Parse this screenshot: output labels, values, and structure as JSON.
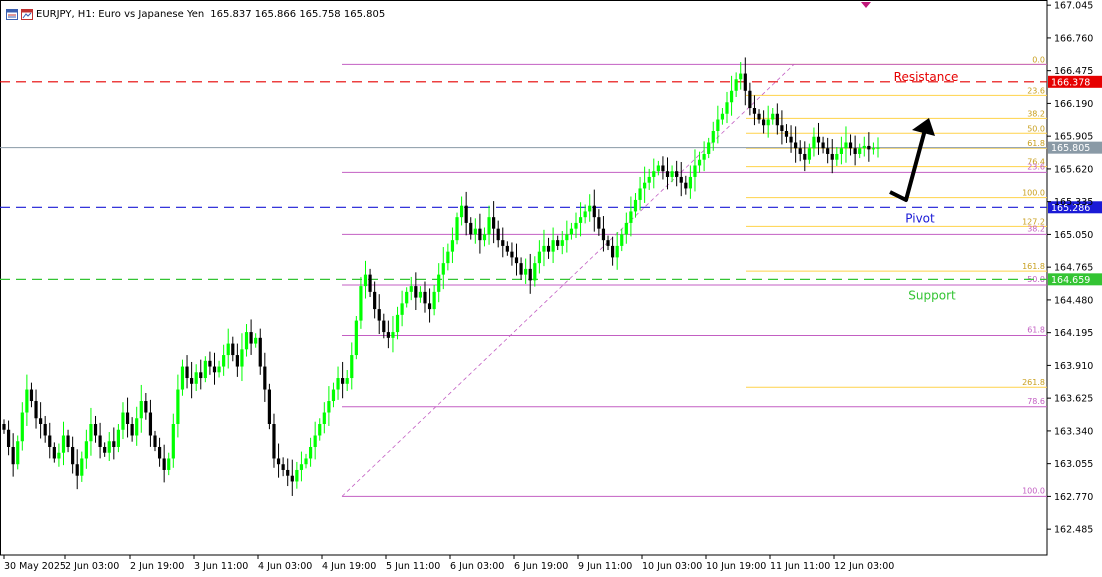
{
  "header": {
    "symbol_line": "EURJPY, H1: Euro vs Japanese Yen",
    "ohlc": "165.837 165.866 165.758 165.805",
    "icons": [
      "chart-window-icon",
      "chart-timeframe-icon"
    ]
  },
  "colors": {
    "bull": "#00ff00",
    "bear": "#000000",
    "fib_upper": "#ffd24a",
    "fib_lower": "#c35fc3",
    "resistance": "#e60000",
    "pivot": "#1a1ad6",
    "support": "#33c433",
    "price_line": "#8a9aa6",
    "axis_text": "#000000"
  },
  "chart_data": {
    "type": "candlestick",
    "symbol": "EURJPY",
    "timeframe": "H1",
    "y_ticks": [
      "167.045",
      "166.760",
      "166.475",
      "166.190",
      "165.905",
      "165.620",
      "165.335",
      "165.050",
      "164.765",
      "164.480",
      "164.195",
      "163.910",
      "163.625",
      "163.340",
      "163.055",
      "162.770",
      "162.485"
    ],
    "ylim": [
      162.26,
      167.09
    ],
    "x_ticks": [
      "30 May 2025",
      "2 Jun 03:00",
      "2 Jun 19:00",
      "3 Jun 11:00",
      "4 Jun 03:00",
      "4 Jun 19:00",
      "5 Jun 11:00",
      "6 Jun 03:00",
      "6 Jun 19:00",
      "9 Jun 11:00",
      "10 Jun 03:00",
      "10 Jun 19:00",
      "11 Jun 11:00",
      "12 Jun 03:00"
    ],
    "bar_count": 192,
    "closes": [
      163.35,
      163.2,
      163.05,
      163.25,
      163.5,
      163.7,
      163.6,
      163.45,
      163.4,
      163.3,
      163.2,
      163.1,
      163.15,
      163.3,
      163.2,
      163.05,
      162.95,
      163.1,
      163.25,
      163.4,
      163.3,
      163.2,
      163.15,
      163.25,
      163.2,
      163.35,
      163.5,
      163.4,
      163.3,
      163.45,
      163.6,
      163.5,
      163.3,
      163.2,
      163.1,
      163.0,
      163.1,
      163.4,
      163.7,
      163.9,
      163.8,
      163.75,
      163.85,
      163.8,
      163.95,
      163.9,
      163.85,
      163.9,
      164.0,
      164.1,
      164.0,
      163.9,
      164.05,
      164.2,
      164.1,
      164.15,
      163.9,
      163.7,
      163.4,
      163.1,
      163.05,
      163.0,
      162.95,
      162.9,
      163.0,
      163.05,
      163.1,
      163.2,
      163.3,
      163.4,
      163.5,
      163.6,
      163.7,
      163.8,
      163.75,
      163.8,
      164.0,
      164.3,
      164.6,
      164.7,
      164.55,
      164.4,
      164.3,
      164.2,
      164.15,
      164.2,
      164.35,
      164.45,
      164.55,
      164.6,
      164.5,
      164.55,
      164.45,
      164.4,
      164.55,
      164.7,
      164.8,
      164.9,
      165.0,
      165.2,
      165.3,
      165.15,
      165.05,
      165.1,
      165.0,
      165.05,
      165.2,
      165.1,
      165.0,
      164.95,
      164.9,
      164.85,
      164.8,
      164.7,
      164.75,
      164.65,
      164.8,
      164.9,
      164.95,
      164.9,
      165.0,
      164.95,
      165.0,
      165.05,
      165.1,
      165.15,
      165.2,
      165.25,
      165.3,
      165.2,
      165.1,
      165.0,
      164.95,
      164.85,
      164.95,
      165.05,
      165.15,
      165.25,
      165.35,
      165.45,
      165.5,
      165.55,
      165.6,
      165.65,
      165.6,
      165.55,
      165.6,
      165.55,
      165.5,
      165.45,
      165.55,
      165.65,
      165.7,
      165.75,
      165.85,
      165.95,
      166.05,
      166.1,
      166.2,
      166.3,
      166.4,
      166.45,
      166.3,
      166.15,
      166.1,
      166.05,
      166.0,
      166.05,
      166.1,
      166.0,
      165.95,
      165.9,
      165.85,
      165.8,
      165.75,
      165.7,
      165.8,
      165.9,
      165.85,
      165.8,
      165.75,
      165.7,
      165.75,
      165.8,
      165.85,
      165.8,
      165.75,
      165.8,
      165.82,
      165.79,
      165.8,
      165.805
    ],
    "fibonacci": {
      "upper_levels": [
        {
          "label": "0.0",
          "price": 166.53
        },
        {
          "label": "23.6",
          "price": 166.26
        },
        {
          "label": "38.2",
          "price": 166.06
        },
        {
          "label": "50.0",
          "price": 165.93
        },
        {
          "label": "61.8",
          "price": 165.8
        },
        {
          "label": "76.4",
          "price": 165.64
        },
        {
          "label": "100.0",
          "price": 165.37
        },
        {
          "label": "127.2",
          "price": 165.12
        },
        {
          "label": "161.8",
          "price": 164.73
        },
        {
          "label": "261.8",
          "price": 163.72
        }
      ],
      "lower_levels": [
        {
          "label": "0.0",
          "price": 166.53
        },
        {
          "label": "23.6",
          "price": 165.59
        },
        {
          "label": "38.2",
          "price": 165.05
        },
        {
          "label": "50.0",
          "price": 164.61
        },
        {
          "label": "61.8",
          "price": 164.17
        },
        {
          "label": "78.6",
          "price": 163.55
        },
        {
          "label": "100.0",
          "price": 162.77
        }
      ]
    },
    "levels": [
      {
        "name": "Resistance",
        "price": 166.378,
        "label": "166.378",
        "color_key": "resistance"
      },
      {
        "name": "Pivot",
        "price": 165.286,
        "label": "165.286",
        "color_key": "pivot"
      },
      {
        "name": "Support",
        "price": 164.659,
        "label": "164.659",
        "color_key": "support"
      }
    ],
    "current_price": {
      "price": 165.805,
      "label": "165.805"
    }
  }
}
